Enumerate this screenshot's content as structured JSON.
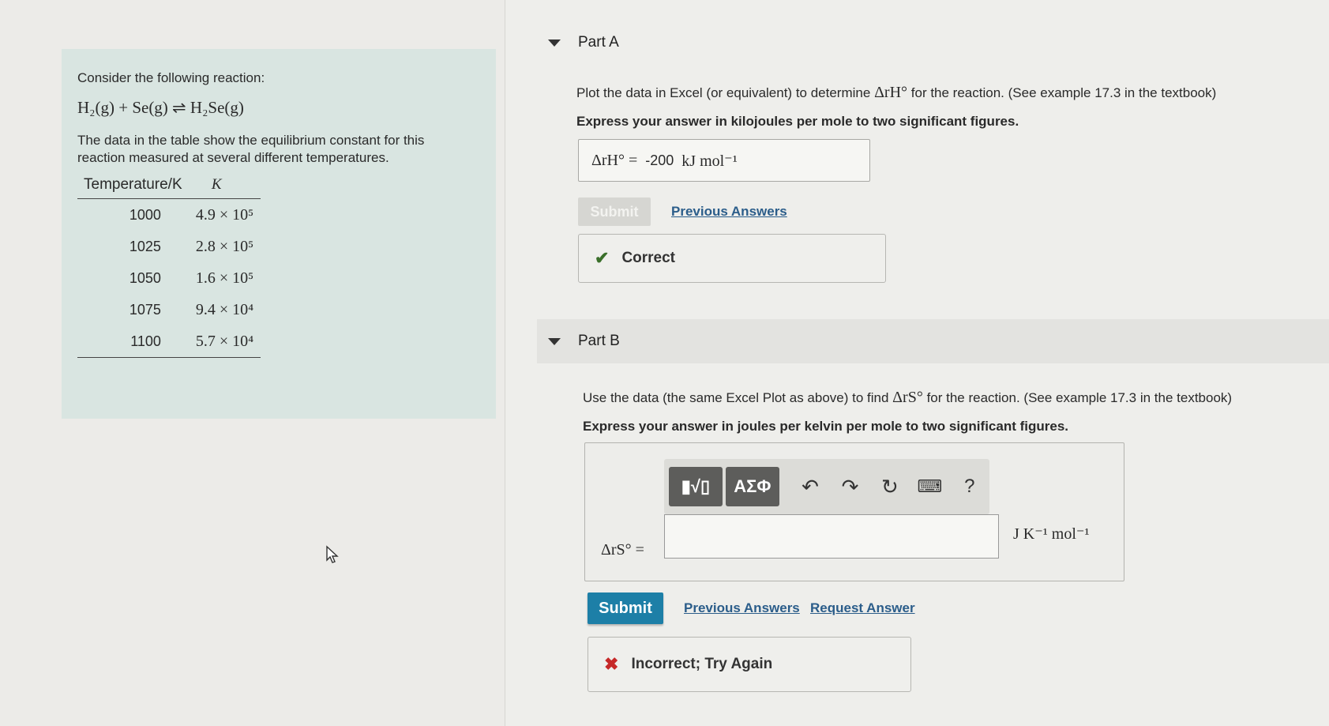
{
  "problem": {
    "intro": "Consider the following reaction:",
    "reaction": "H₂(g) + Se(g) ⇌ H₂Se(g)",
    "description": "The data in the table show the equilibrium constant for this reaction measured at several different temperatures.",
    "table": {
      "headers": [
        "Temperature/K",
        "K"
      ],
      "rows": [
        {
          "t": "1000",
          "k": "4.9 × 10⁵"
        },
        {
          "t": "1025",
          "k": "2.8 × 10⁵"
        },
        {
          "t": "1050",
          "k": "1.6 × 10⁵"
        },
        {
          "t": "1075",
          "k": "9.4 × 10⁴"
        },
        {
          "t": "1100",
          "k": "5.7 × 10⁴"
        }
      ]
    }
  },
  "partA": {
    "title": "Part A",
    "prompt_before": "Plot the data in Excel (or equivalent) to determine",
    "prompt_math": "ΔrH°",
    "prompt_after": "for the reaction. (See example 17.3 in the textbook)",
    "instruction": "Express your answer in kilojoules per mole to two significant figures.",
    "answer_label": "ΔrH° =",
    "answer_value": "-200",
    "answer_unit": "kJ mol⁻¹",
    "submit_label": "Submit",
    "prev_answers_label": "Previous Answers",
    "feedback": "Correct",
    "feedback_color": "#3a6f2a"
  },
  "partB": {
    "title": "Part B",
    "prompt_before": "Use the data (the same Excel Plot as above) to find",
    "prompt_math": "ΔrS°",
    "prompt_after": "for the reaction. (See example 17.3 in the textbook)",
    "instruction": "Express your answer in joules per kelvin per mole to two significant figures.",
    "toolbar": {
      "template_btn": "▮√▯",
      "greek_btn": "ΑΣΦ",
      "help": "?"
    },
    "answer_label": "ΔrS° =",
    "answer_value": "",
    "answer_unit": "J K⁻¹ mol⁻¹",
    "submit_label": "Submit",
    "prev_answers_label": "Previous Answers",
    "request_answer_label": "Request Answer",
    "feedback": "Incorrect; Try Again",
    "feedback_color": "#c62828",
    "accent_color": "#1d7fa7"
  }
}
